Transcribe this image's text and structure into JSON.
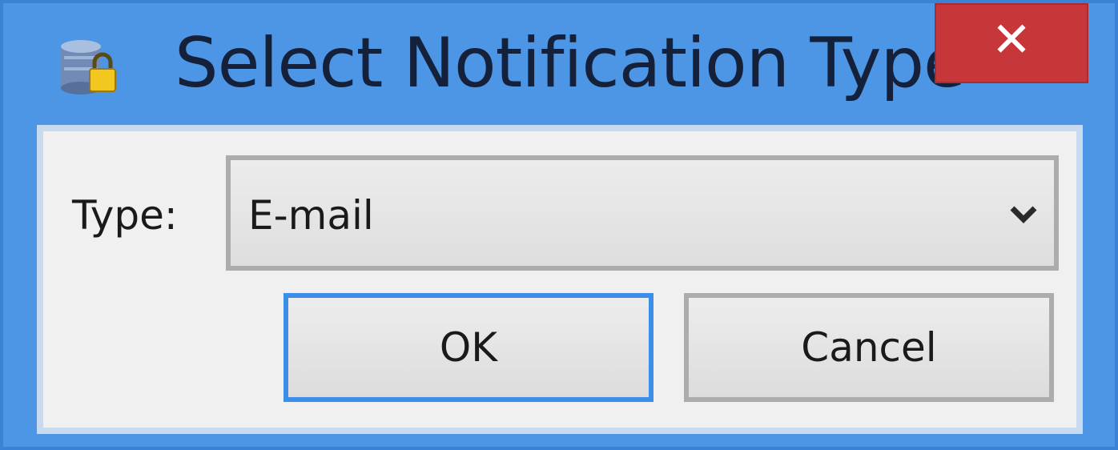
{
  "window": {
    "title": "Select Notification Type",
    "close_glyph": "✕",
    "accent_color": "#4d96e6",
    "close_color": "#c7373a"
  },
  "app_icon": {
    "name": "database-lock-icon"
  },
  "form": {
    "type_label": "Type:",
    "type_value": "E-mail",
    "dropdown_icon": "chevron-down-icon"
  },
  "buttons": {
    "ok_label": "OK",
    "cancel_label": "Cancel"
  }
}
